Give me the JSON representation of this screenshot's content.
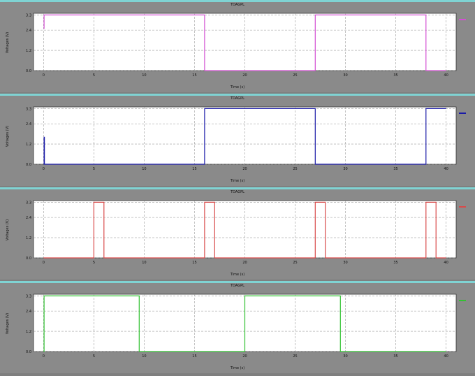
{
  "panels": [
    {
      "title": "TDAGPL",
      "ylabel": "Voltages (V)",
      "xlabel": "Time (s)",
      "legend": "",
      "color": "#d34fd3"
    },
    {
      "title": "TDAGPL",
      "ylabel": "Voltages (V)",
      "xlabel": "Time (s)",
      "legend": "",
      "color": "#1a1aa8"
    },
    {
      "title": "TDAGPL",
      "ylabel": "Voltages (V)",
      "xlabel": "Time (s)",
      "legend": "",
      "color": "#d94a4a"
    },
    {
      "title": "TDAGPL",
      "ylabel": "Voltages (V)",
      "xlabel": "Time (s)",
      "legend": "",
      "color": "#31c231"
    }
  ],
  "chart_data": [
    {
      "type": "line",
      "title": "TDAGPL",
      "xlabel": "Time (s)",
      "ylabel": "Voltages (V)",
      "xlim": [
        -1,
        41
      ],
      "ylim": [
        0.0,
        3.4
      ],
      "x_ticks": [
        0,
        5,
        10,
        15,
        20,
        25,
        30,
        35,
        40
      ],
      "y_ticks": [
        0.0,
        1.2,
        2.4,
        3.3
      ],
      "grid": true,
      "legend": "right",
      "series": [
        {
          "x": [
            0,
            0.05,
            0.05,
            16.0,
            16.0,
            27.0,
            27.0,
            38.0,
            38.0,
            40.0
          ],
          "y": [
            2.5,
            2.5,
            3.3,
            3.3,
            0.0,
            0.0,
            3.3,
            3.3,
            0.0,
            0.0
          ]
        }
      ]
    },
    {
      "type": "line",
      "title": "TDAGPL",
      "xlabel": "Time (s)",
      "ylabel": "Voltages (V)",
      "xlim": [
        -1,
        41
      ],
      "ylim": [
        0.0,
        3.4
      ],
      "x_ticks": [
        0,
        5,
        10,
        15,
        20,
        25,
        30,
        35,
        40
      ],
      "y_ticks": [
        0.0,
        1.2,
        2.4,
        3.3
      ],
      "grid": true,
      "legend": "right",
      "series": [
        {
          "x": [
            0,
            0.05,
            0.05,
            0.08,
            0.08,
            16.0,
            16.0,
            27.0,
            27.0,
            38.0,
            38.0,
            40.0
          ],
          "y": [
            0.0,
            0.0,
            1.6,
            1.6,
            0.0,
            0.0,
            3.3,
            3.3,
            0.0,
            0.0,
            3.3,
            3.3
          ]
        }
      ]
    },
    {
      "type": "line",
      "title": "TDAGPL",
      "xlabel": "Time (s)",
      "ylabel": "Voltages (V)",
      "xlim": [
        -1,
        41
      ],
      "ylim": [
        0.0,
        3.4
      ],
      "x_ticks": [
        0,
        5,
        10,
        15,
        20,
        25,
        30,
        35,
        40
      ],
      "y_ticks": [
        0.0,
        1.2,
        2.4,
        3.3
      ],
      "grid": true,
      "legend": "right",
      "series": [
        {
          "x": [
            0,
            5.0,
            5.0,
            6.0,
            6.0,
            16.0,
            16.0,
            17.0,
            17.0,
            27.0,
            27.0,
            28.0,
            28.0,
            38.0,
            38.0,
            39.0,
            39.0,
            40.0
          ],
          "y": [
            0.0,
            0.0,
            3.3,
            3.3,
            0.0,
            0.0,
            3.3,
            3.3,
            0.0,
            0.0,
            3.3,
            3.3,
            0.0,
            0.0,
            3.3,
            3.3,
            0.0,
            0.0
          ]
        }
      ]
    },
    {
      "type": "line",
      "title": "TDAGPL",
      "xlabel": "Time (s)",
      "ylabel": "Voltages (V)",
      "xlim": [
        -1,
        41
      ],
      "ylim": [
        0.0,
        3.4
      ],
      "x_ticks": [
        0,
        5,
        10,
        15,
        20,
        25,
        30,
        35,
        40
      ],
      "y_ticks": [
        0.0,
        1.2,
        2.4,
        3.3
      ],
      "grid": true,
      "legend": "right",
      "series": [
        {
          "x": [
            0,
            0.05,
            0.05,
            9.5,
            9.5,
            20.0,
            20.0,
            29.5,
            29.5,
            40.0
          ],
          "y": [
            0.0,
            0.0,
            3.3,
            3.3,
            0.0,
            0.0,
            3.3,
            3.3,
            0.0,
            0.0
          ]
        }
      ]
    }
  ]
}
